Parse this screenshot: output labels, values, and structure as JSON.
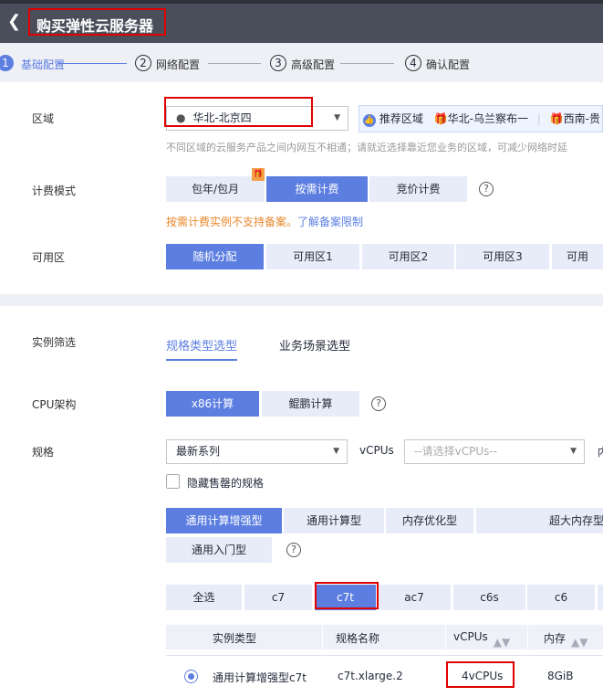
{
  "header": {
    "title": "购买弹性云服务器",
    "back": "chevron-left-icon"
  },
  "steps": [
    {
      "num": "1",
      "label": "基础配置",
      "active": true
    },
    {
      "num": "2",
      "label": "网络配置"
    },
    {
      "num": "3",
      "label": "高级配置"
    },
    {
      "num": "4",
      "label": "确认配置"
    }
  ],
  "region": {
    "label": "区域",
    "value": "华北-北京四",
    "recommend_label": "推荐区域",
    "recommend": [
      "华北-乌兰察布一",
      "西南-贵"
    ],
    "hint": "不同区域的云服务产品之间内网互不相通；请就近选择靠近您业务的区域，可减少网络时延"
  },
  "billing": {
    "label": "计费模式",
    "options": [
      "包年/包月",
      "按需计费",
      "竞价计费"
    ],
    "selected": "按需计费",
    "warn": "按需计费实例不支持备案。",
    "link": "了解备案限制"
  },
  "az": {
    "label": "可用区",
    "options": [
      "随机分配",
      "可用区1",
      "可用区2",
      "可用区3",
      "可用"
    ],
    "selected": "随机分配"
  },
  "filter": {
    "label": "实例筛选",
    "tabs": [
      "规格类型选型",
      "业务场景选型"
    ],
    "active": "规格类型选型"
  },
  "cpu": {
    "label": "CPU架构",
    "options": [
      "x86计算",
      "鲲鹏计算"
    ],
    "selected": "x86计算"
  },
  "spec": {
    "label": "规格",
    "series_value": "最新系列",
    "vcpus_label": "vCPUs",
    "vcpus_placeholder": "--请选择vCPUs--",
    "cut": "内",
    "hide_sold_out": "隐藏售罄的规格"
  },
  "types": {
    "options": [
      "通用计算增强型",
      "通用计算型",
      "内存优化型",
      "超大内存型",
      "通用入门型"
    ],
    "selected": "通用计算增强型"
  },
  "series": {
    "options": [
      "全选",
      "c7",
      "c7t",
      "ac7",
      "c6s",
      "c6"
    ],
    "selected": "c7t"
  },
  "table": {
    "headers": [
      "实例类型",
      "规格名称",
      "vCPUs",
      "内存"
    ],
    "rows": [
      {
        "type": "通用计算增强型c7t",
        "name": "c7t.xlarge.2",
        "vcpus": "4vCPUs",
        "mem": "8GiB",
        "selected": true
      }
    ]
  },
  "colors": {
    "accent": "#5c7ee0",
    "header": "#4a4e5b",
    "warn": "#e8872b",
    "annotation": "#e00000"
  }
}
